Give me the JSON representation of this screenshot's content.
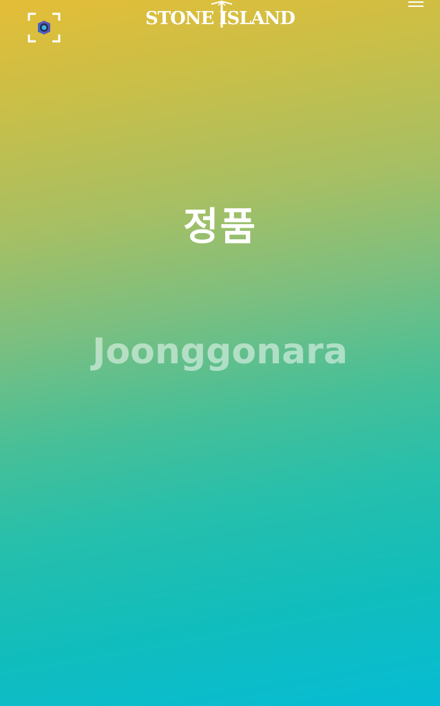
{
  "header": {
    "brand_left": "STONE",
    "brand_right": "ISLAND",
    "scan_icon": "camera-scan-icon",
    "menu_icon": "hamburger-menu-icon"
  },
  "main": {
    "headline": "정품",
    "watermark": "Joonggonara"
  },
  "colors": {
    "gradient_top": "#e4bd37",
    "gradient_middle": "#46bf98",
    "gradient_bottom": "#06bbd4",
    "text": "#ffffff"
  }
}
